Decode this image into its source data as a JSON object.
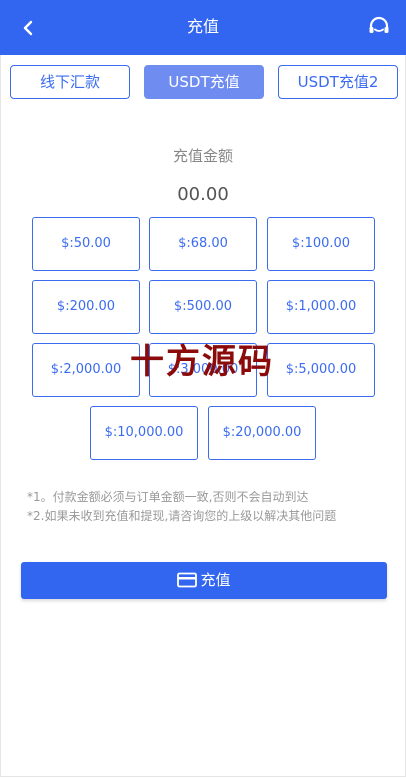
{
  "header": {
    "title": "充值",
    "background": "#3266f0"
  },
  "tabs": [
    {
      "label": "线下汇款",
      "active": false
    },
    {
      "label": "USDT充值",
      "active": true
    },
    {
      "label": "USDT充值2",
      "active": false
    }
  ],
  "amount_section": {
    "label": "充值金额",
    "value": "00.00"
  },
  "amount_options": [
    "$:50.00",
    "$:68.00",
    "$:100.00",
    "$:200.00",
    "$:500.00",
    "$:1,000.00",
    "$:2,000.00",
    "$:3,000.00",
    "$:5,000.00",
    "$:10,000.00",
    "$:20,000.00"
  ],
  "watermark": "十方源码",
  "notes": [
    "*1。付款金额必须与订单金额一致,否则不会自动到达",
    "*2.如果未收到充值和提现,请咨询您的上级以解决其他问题"
  ],
  "submit": {
    "label": "充值",
    "icon": "card-icon"
  },
  "colors": {
    "primary": "#3266f0",
    "tab_active": "#6f8df0",
    "watermark": "#8b0a0a"
  }
}
